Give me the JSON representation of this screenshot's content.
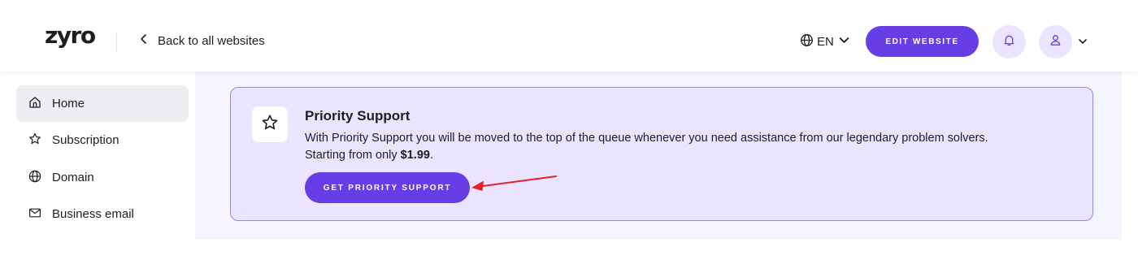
{
  "header": {
    "logo": "zyro",
    "back_label": "Back to all websites",
    "language": "EN",
    "edit_button": "EDIT WEBSITE"
  },
  "sidebar": {
    "items": [
      {
        "label": "Home",
        "icon": "home-icon",
        "active": true
      },
      {
        "label": "Subscription",
        "icon": "star-icon",
        "active": false
      },
      {
        "label": "Domain",
        "icon": "globe-icon",
        "active": false
      },
      {
        "label": "Business email",
        "icon": "mail-icon",
        "active": false
      }
    ]
  },
  "card": {
    "icon": "star-icon",
    "title": "Priority Support",
    "description_line1": "With Priority Support you will be moved to the top of the queue whenever you need assistance from our legendary problem solvers.",
    "description_prefix": "Starting from only ",
    "price": "$1.99",
    "description_suffix": ".",
    "button_label": "GET PRIORITY SUPPORT"
  },
  "annotation": {
    "type": "arrow",
    "color": "#e5202b",
    "points_to": "get-priority-support-button"
  },
  "colors": {
    "accent": "#673de6",
    "card_background": "#ebe4ff",
    "card_border": "#8c85ff",
    "main_background": "#f4f5ff"
  }
}
